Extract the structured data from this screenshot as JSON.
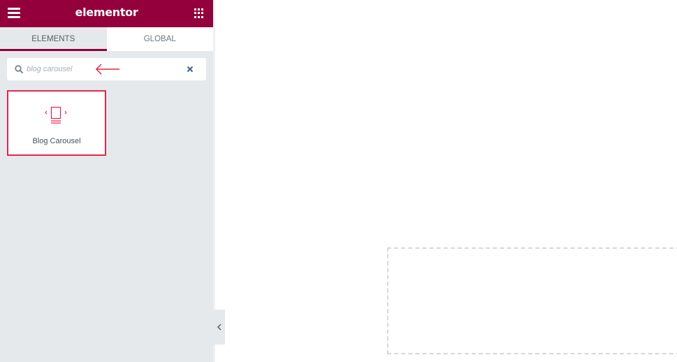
{
  "header": {
    "logo": "elementor",
    "menu_icon": "hamburger-icon",
    "apps_icon": "grid-icon",
    "brand_color": "#93003c"
  },
  "tabs": [
    {
      "label": "ELEMENTS",
      "active": true
    },
    {
      "label": "GLOBAL",
      "active": false
    }
  ],
  "search": {
    "value": "blog carousel",
    "search_icon": "search-icon",
    "clear_icon": "close-icon",
    "annotation": "arrow-left-icon"
  },
  "results": [
    {
      "label": "Blog Carousel",
      "icon": "carousel-icon",
      "highlight_color": "#e2264d"
    }
  ],
  "panel": {
    "collapse_icon": "chevron-left-icon"
  }
}
